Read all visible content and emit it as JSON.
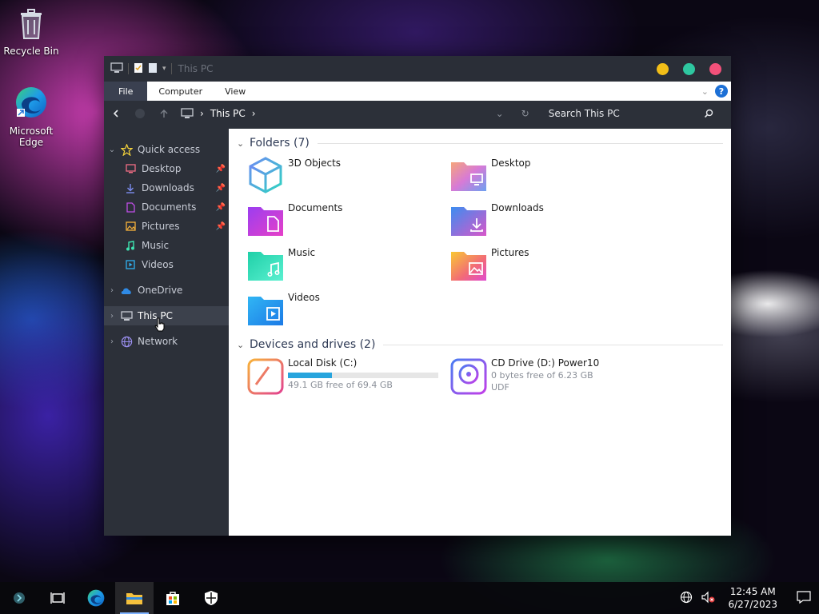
{
  "desktop": {
    "icons": [
      {
        "label": "Recycle Bin"
      },
      {
        "label": "Microsoft Edge"
      }
    ]
  },
  "window": {
    "title": "This PC",
    "buttons": {
      "minimize_color": "#f2be18",
      "maximize_color": "#2ec7a0",
      "close_color": "#f2517a"
    },
    "ribbon": {
      "tabs": [
        "File",
        "Computer",
        "View"
      ],
      "help": "?"
    },
    "address": {
      "location": "This PC",
      "search_placeholder": "Search This PC"
    },
    "navigation": {
      "quick_access": "Quick access",
      "quick_items": [
        {
          "label": "Desktop",
          "pinned": true,
          "icon": "desktop-icon"
        },
        {
          "label": "Downloads",
          "pinned": true,
          "icon": "downloads-icon"
        },
        {
          "label": "Documents",
          "pinned": true,
          "icon": "documents-icon"
        },
        {
          "label": "Pictures",
          "pinned": true,
          "icon": "pictures-icon"
        },
        {
          "label": "Music",
          "pinned": false,
          "icon": "music-icon"
        },
        {
          "label": "Videos",
          "pinned": false,
          "icon": "videos-icon"
        }
      ],
      "onedrive": "OneDrive",
      "this_pc": "This PC",
      "network": "Network"
    },
    "content": {
      "folders_header": "Folders (7)",
      "folders": [
        {
          "label": "3D Objects",
          "icon": "3d-objects-icon"
        },
        {
          "label": "Desktop",
          "icon": "desktop-folder-icon"
        },
        {
          "label": "Documents",
          "icon": "documents-folder-icon"
        },
        {
          "label": "Downloads",
          "icon": "downloads-folder-icon"
        },
        {
          "label": "Music",
          "icon": "music-folder-icon"
        },
        {
          "label": "Pictures",
          "icon": "pictures-folder-icon"
        },
        {
          "label": "Videos",
          "icon": "videos-folder-icon"
        }
      ],
      "devices_header": "Devices and drives (2)",
      "drives": [
        {
          "label": "Local Disk (C:)",
          "free": "49.1 GB free of 69.4 GB",
          "used_fraction": 0.29
        },
        {
          "label": "CD Drive (D:) Power10",
          "free": "0 bytes free of 6.23 GB",
          "fs": "UDF"
        }
      ]
    }
  },
  "taskbar": {
    "clock_time": "12:45 AM",
    "clock_date": "6/27/2023",
    "items": [
      "start-icon",
      "task-view-icon",
      "edge-icon",
      "file-explorer-icon",
      "store-icon",
      "security-icon"
    ]
  }
}
